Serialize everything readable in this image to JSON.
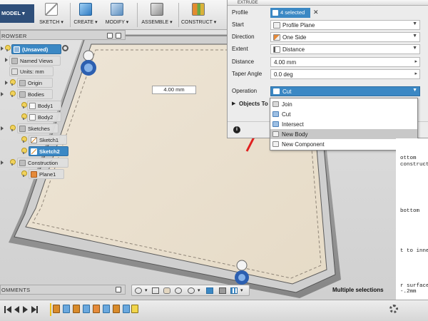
{
  "toolbar": {
    "workspace": "MODEL ▾",
    "groups": [
      {
        "label": "SKETCH",
        "icon": "sketch-icon"
      },
      {
        "label": "CREATE",
        "icon": "create-icon"
      },
      {
        "label": "MODIFY",
        "icon": "modify-icon"
      },
      {
        "label": "ASSEMBLE",
        "icon": "assemble-icon"
      },
      {
        "label": "CONSTRUCT",
        "icon": "construct-icon"
      }
    ]
  },
  "browser": {
    "title": "ROWSER",
    "items": [
      {
        "label": "(Unsaved)",
        "icon": "document-icon"
      },
      {
        "label": "Named Views",
        "icon": "folder-icon"
      },
      {
        "label": "Units: mm",
        "icon": "units-icon"
      },
      {
        "label": "Origin",
        "icon": "folder-icon"
      },
      {
        "label": "Bodies",
        "icon": "folder-icon"
      },
      {
        "label": "Body1",
        "icon": "body-icon"
      },
      {
        "label": "Body2",
        "icon": "body-icon"
      },
      {
        "label": "Sketches",
        "icon": "folder-icon"
      },
      {
        "label": "Sketch1",
        "icon": "sketch-icon"
      },
      {
        "label": "Sketch2",
        "icon": "sketch-icon"
      },
      {
        "label": "Construction",
        "icon": "folder-icon"
      },
      {
        "label": "Plane1",
        "icon": "plane-icon"
      }
    ]
  },
  "dialog": {
    "title": "EXTRUDE",
    "profile": {
      "label": "Profile",
      "value": "4 selected"
    },
    "start": {
      "label": "Start",
      "value": "Profile Plane"
    },
    "direction": {
      "label": "Direction",
      "value": "One Side"
    },
    "extent": {
      "label": "Extent",
      "value": "Distance"
    },
    "distance": {
      "label": "Distance",
      "value": "4.00 mm"
    },
    "taper": {
      "label": "Taper Angle",
      "value": "0.0 deg"
    },
    "operation": {
      "label": "Operation",
      "value": "Cut"
    },
    "objects_to_cut": "Objects To"
  },
  "operation_menu": {
    "options": [
      "Join",
      "Cut",
      "Intersect",
      "New Body",
      "New Component"
    ],
    "highlighted": "New Body"
  },
  "viewport": {
    "distance_input": "4.00 mm",
    "status": "Multiple selections"
  },
  "code_panel": {
    "lines": [
      "ottom",
      "construct",
      "bottom",
      "t to inne",
      "r surface",
      "-.2mm",
      "urface"
    ]
  },
  "comments": {
    "title": "OMMENTS"
  },
  "colors": {
    "selection_blue": "#3b88c4",
    "toolbar_dark": "#2f4f7a",
    "arrow_red": "#e02020",
    "tray_beige": "#ede4d4"
  }
}
